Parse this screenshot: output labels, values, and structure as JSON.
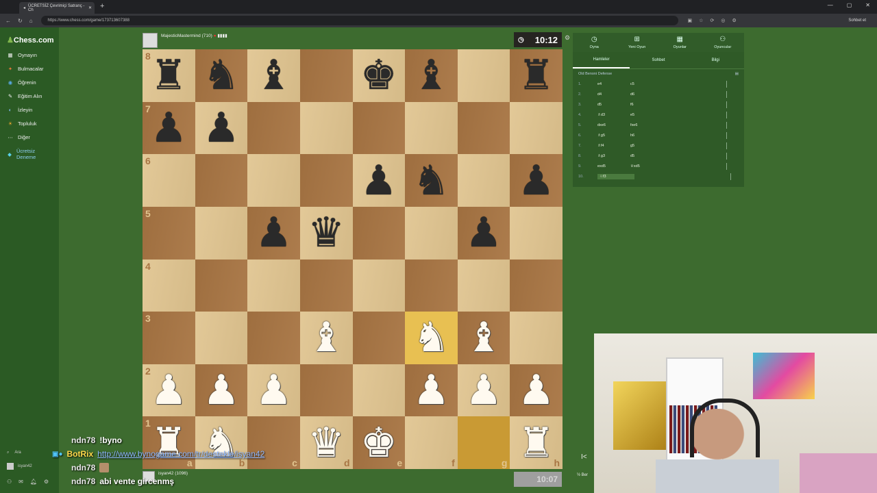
{
  "browser": {
    "tab_title": "ÜCRETSİZ Çevrimiçi Satranç - Ch",
    "url": "https://www.chess.com/game/173713607388",
    "chat_button": "Sohbet et"
  },
  "sidebar": {
    "logo": "Chess.com",
    "items": [
      {
        "label": "Oynayın",
        "icon": "board-icon"
      },
      {
        "label": "Bulmacalar",
        "icon": "puzzle-icon"
      },
      {
        "label": "Öğrenin",
        "icon": "learn-icon"
      },
      {
        "label": "Eğitim Alın",
        "icon": "coach-icon"
      },
      {
        "label": "İzleyin",
        "icon": "watch-icon"
      },
      {
        "label": "Topluluk",
        "icon": "community-icon"
      },
      {
        "label": "Diğer",
        "icon": "more-icon"
      },
      {
        "label": "Ücretsiz Deneme",
        "icon": "diamond-icon"
      }
    ],
    "search_label": "Ara",
    "user_label": "isyan42"
  },
  "top_player": {
    "name": "MajesticMastermind",
    "rating": "(710)",
    "clock": "10:12"
  },
  "bottom_player": {
    "name": "isyan42",
    "rating": "(1096)",
    "clock": "10:07"
  },
  "board": {
    "highlight": [
      "f3",
      "g1"
    ],
    "rows": [
      [
        "r",
        "n",
        "b",
        "",
        "k",
        "b",
        "",
        "r"
      ],
      [
        "p",
        "p",
        "",
        "",
        "",
        "",
        "",
        ""
      ],
      [
        "",
        "",
        "",
        "",
        "p",
        "n",
        "",
        "p"
      ],
      [
        "",
        "",
        "p",
        "q",
        "",
        "",
        "p",
        ""
      ],
      [
        "",
        "",
        "",
        "",
        "",
        "",
        "",
        ""
      ],
      [
        "",
        "",
        "",
        "B",
        "",
        "N",
        "B",
        ""
      ],
      [
        "P",
        "P",
        "P",
        "",
        "",
        "P",
        "P",
        "P"
      ],
      [
        "R",
        "N",
        "",
        "Q",
        "K",
        "",
        "",
        "R"
      ]
    ],
    "ranks": [
      "8",
      "7",
      "6",
      "5",
      "4",
      "3",
      "2",
      "1"
    ],
    "files": [
      "a",
      "b",
      "c",
      "d",
      "e",
      "f",
      "g",
      "h"
    ]
  },
  "panel": {
    "tabs": [
      "Oyna",
      "Yeni Oyun",
      "Oyunlar",
      "Oyuncular"
    ],
    "subtabs": [
      "Hamleler",
      "Sohbet",
      "Bilgi"
    ],
    "opening": "Old Benoni Defense",
    "moves": [
      {
        "n": "1.",
        "w": "e4",
        "b": "c5"
      },
      {
        "n": "2.",
        "w": "d4",
        "b": "d6"
      },
      {
        "n": "3.",
        "w": "d5",
        "b": "f6"
      },
      {
        "n": "4.",
        "w": "♗d3",
        "b": "e5"
      },
      {
        "n": "5.",
        "w": "dxe6",
        "b": "fxe6"
      },
      {
        "n": "6.",
        "w": "♗g5",
        "b": "h6"
      },
      {
        "n": "7.",
        "w": "♗f4",
        "b": "g5"
      },
      {
        "n": "8.",
        "w": "♗g3",
        "b": "d5"
      },
      {
        "n": "9.",
        "w": "exd5",
        "b": "♕xd5"
      },
      {
        "n": "10.",
        "w": "♘f3",
        "b": ""
      }
    ]
  },
  "chat": [
    {
      "user": "ndn78",
      "text": "!byno",
      "type": "user"
    },
    {
      "user": "BotRix",
      "text": "http://www.bynogame.com/tr/destekle/isyan42",
      "type": "bot"
    },
    {
      "user": "ndn78",
      "text": "",
      "type": "emote"
    },
    {
      "user": "ndn78",
      "text": "abi vente gircenmş",
      "type": "user"
    }
  ],
  "partial_label": "½ Ber"
}
